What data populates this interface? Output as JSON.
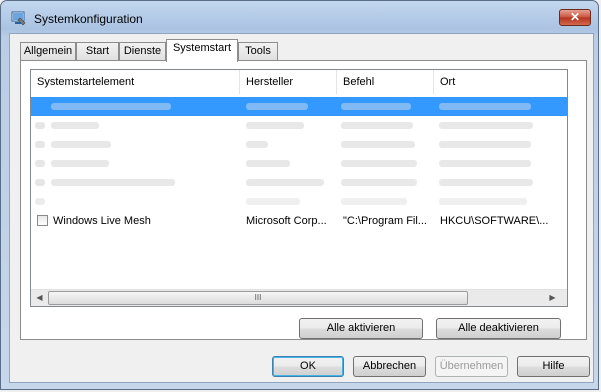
{
  "window": {
    "title": "Systemkonfiguration",
    "close_label": "✕",
    "app_icon": "msconfig-icon"
  },
  "tabs": [
    "Allgemein",
    "Start",
    "Dienste",
    "Systemstart",
    "Tools"
  ],
  "active_tab": "Systemstart",
  "table": {
    "columns": [
      "Systemstartelement",
      "Hersteller",
      "Befehl",
      "Ort"
    ],
    "visible_row": {
      "checked": false,
      "element": "Windows Live Mesh",
      "manufacturer": "Microsoft Corp...",
      "command": "\"C:\\Program Fil...",
      "location": "HKCU\\SOFTWARE\\..."
    },
    "hscroll_grip": "III"
  },
  "buttons": {
    "enable_all": "Alle aktivieren",
    "disable_all": "Alle deaktivieren",
    "ok": "OK",
    "cancel": "Abbrechen",
    "apply": "Übernehmen",
    "help": "Hilfe"
  }
}
